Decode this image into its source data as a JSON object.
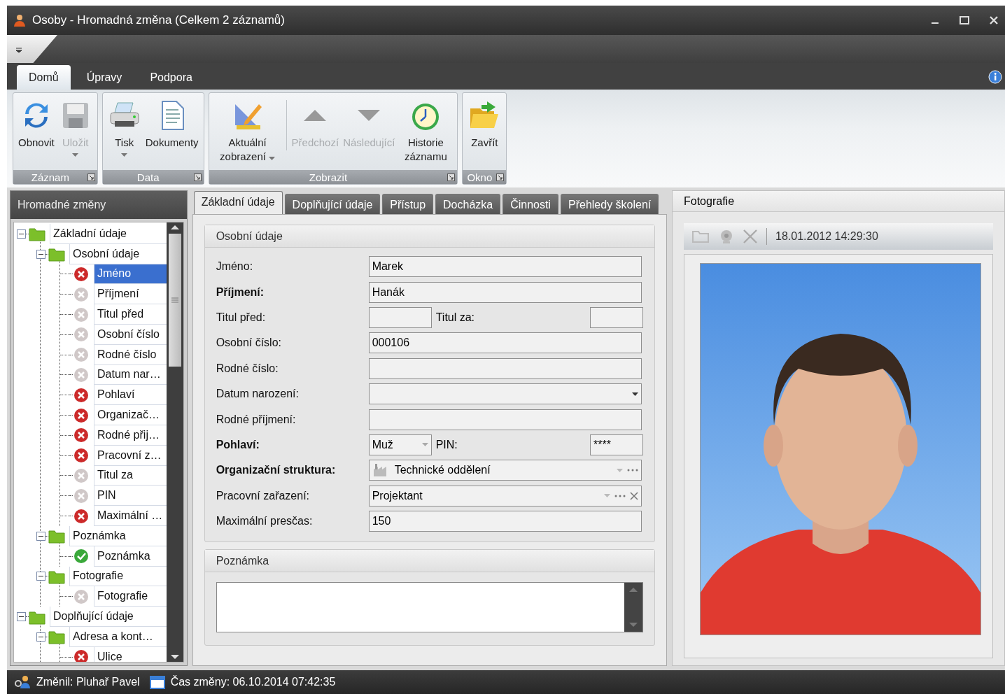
{
  "window": {
    "title": "Osoby - Hromadná změna (Celkem 2 záznamů)"
  },
  "ribbon": {
    "tabs": [
      {
        "label": "Domů",
        "selected": true
      },
      {
        "label": "Úpravy",
        "selected": false
      },
      {
        "label": "Podpora",
        "selected": false
      }
    ],
    "groups": [
      {
        "label": "Záznam",
        "buttons": [
          {
            "kind": "refresh",
            "label": "Obnovit",
            "disabled": false,
            "dropdown": false
          },
          {
            "kind": "save",
            "label": "Uložit",
            "disabled": true,
            "dropdown": true
          }
        ]
      },
      {
        "label": "Data",
        "buttons": [
          {
            "kind": "print",
            "label": "Tisk",
            "disabled": false,
            "dropdown": true
          },
          {
            "kind": "document",
            "label": "Dokumenty",
            "disabled": false,
            "dropdown": false
          }
        ]
      },
      {
        "label": "Zobrazit",
        "buttons": [
          {
            "kind": "ruler",
            "label": "Aktuální zobrazení",
            "disabled": false,
            "dropdown": true
          },
          {
            "kind": "separator"
          },
          {
            "kind": "up",
            "label": "Předchozí",
            "disabled": true,
            "dropdown": false
          },
          {
            "kind": "down",
            "label": "Následující",
            "disabled": true,
            "dropdown": false
          },
          {
            "kind": "history",
            "label": "Historie záznamu",
            "disabled": false,
            "dropdown": false
          }
        ]
      },
      {
        "label": "Okno",
        "buttons": [
          {
            "kind": "folder",
            "label": "Zavřít",
            "disabled": false,
            "dropdown": false
          }
        ]
      }
    ]
  },
  "tree_panel": {
    "title": "Hromadné změny",
    "items": [
      {
        "label": "Základní údaje",
        "kind": "folder",
        "expanded": true,
        "selected": false,
        "children": [
          {
            "label": "Osobní údaje",
            "kind": "folder",
            "expanded": true,
            "selected": false,
            "children": [
              {
                "label": "Jméno",
                "kind": "error",
                "selected": true
              },
              {
                "label": "Příjmení",
                "kind": "unset",
                "selected": false
              },
              {
                "label": "Titul před",
                "kind": "unset",
                "selected": false
              },
              {
                "label": "Osobní číslo",
                "kind": "unset",
                "selected": false
              },
              {
                "label": "Rodné číslo",
                "kind": "unset",
                "selected": false
              },
              {
                "label": "Datum nar…",
                "kind": "unset",
                "selected": false
              },
              {
                "label": "Pohlaví",
                "kind": "error",
                "selected": false
              },
              {
                "label": "Organizač…",
                "kind": "error",
                "selected": false
              },
              {
                "label": "Rodné přij…",
                "kind": "error",
                "selected": false
              },
              {
                "label": "Pracovní z…",
                "kind": "error",
                "selected": false
              },
              {
                "label": "Titul za",
                "kind": "unset",
                "selected": false
              },
              {
                "label": "PIN",
                "kind": "unset",
                "selected": false
              },
              {
                "label": "Maximální …",
                "kind": "error",
                "selected": false
              }
            ]
          },
          {
            "label": "Poznámka",
            "kind": "folder",
            "expanded": true,
            "selected": false,
            "children": [
              {
                "label": "Poznámka",
                "kind": "ok",
                "selected": false
              }
            ]
          },
          {
            "label": "Fotografie",
            "kind": "folder",
            "expanded": true,
            "selected": false,
            "children": [
              {
                "label": "Fotografie",
                "kind": "unset",
                "selected": false
              }
            ]
          }
        ]
      },
      {
        "label": "Doplňující údaje",
        "kind": "folder",
        "expanded": true,
        "selected": false,
        "children": [
          {
            "label": "Adresa a kont…",
            "kind": "folder",
            "expanded": true,
            "selected": false,
            "children": [
              {
                "label": "Ulice",
                "kind": "error",
                "selected": false
              }
            ]
          }
        ]
      }
    ]
  },
  "form": {
    "tabs": [
      {
        "label": "Základní údaje",
        "selected": true
      },
      {
        "label": "Doplňující údaje",
        "selected": false
      },
      {
        "label": "Přístup",
        "selected": false
      },
      {
        "label": "Docházka",
        "selected": false
      },
      {
        "label": "Činnosti",
        "selected": false
      },
      {
        "label": "Přehledy školení",
        "selected": false
      }
    ],
    "personal": {
      "title": "Osobní údaje",
      "rows": [
        {
          "kind": "text",
          "label": "Jméno:",
          "bold": false,
          "value": "Marek"
        },
        {
          "kind": "text",
          "label": "Příjmení:",
          "bold": true,
          "value": "Hanák"
        },
        {
          "kind": "pair",
          "label": "Titul před:",
          "bold": false,
          "dropdown": false,
          "label_2": "Titul za:"
        },
        {
          "kind": "text",
          "label": "Osobní číslo:",
          "bold": false,
          "value": "000106"
        },
        {
          "kind": "text",
          "label": "Rodné číslo:",
          "bold": false
        },
        {
          "kind": "date",
          "label": "Datum narození:",
          "bold": false
        },
        {
          "kind": "text",
          "label": "Rodné příjmení:",
          "bold": false
        },
        {
          "kind": "pair",
          "label": "Pohlaví:",
          "bold": true,
          "dropdown": true,
          "value": "Muž",
          "label_2": "PIN:",
          "value_2": "****"
        },
        {
          "kind": "lookup",
          "label": "Organizační struktura:",
          "bold": true,
          "value": "Technické oddělení",
          "has_icon": true,
          "clearable": false
        },
        {
          "kind": "lookup",
          "label": "Pracovní zařazení:",
          "bold": false,
          "value": "Projektant",
          "has_icon": false,
          "clearable": true
        },
        {
          "kind": "text",
          "label": "Maximální presčas:",
          "bold": false,
          "value": "150"
        }
      ]
    },
    "note": {
      "title": "Poznámka"
    }
  },
  "photo_panel": {
    "title": "Fotografie",
    "timestamp": "18.01.2012 14:29:30"
  },
  "status_bar": {
    "changed_by": "Změnil: Pluhař Pavel",
    "changed_at": "Čas změny: 06.10.2014 07:42:35"
  }
}
